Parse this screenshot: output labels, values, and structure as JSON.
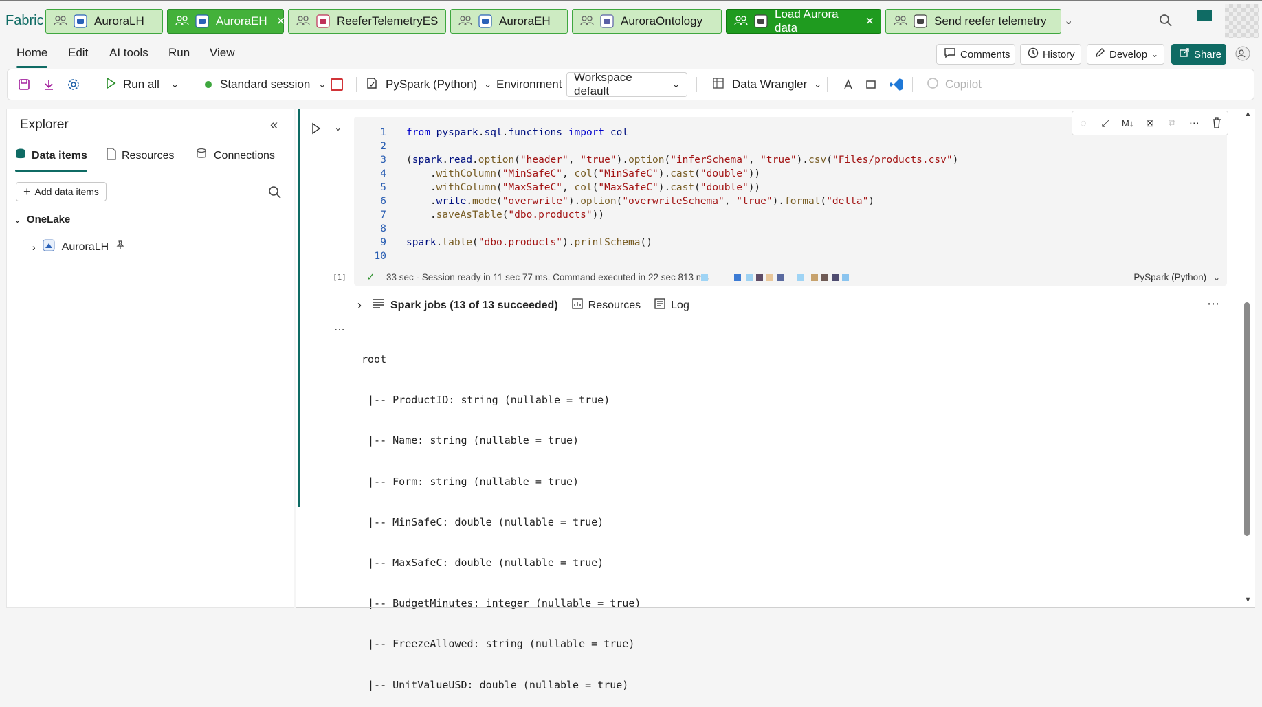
{
  "app": {
    "brand": "Fabric"
  },
  "tabs": [
    {
      "label": "AuroraLH",
      "state": "normal",
      "closable": false
    },
    {
      "label": "AuroraEH",
      "state": "active",
      "closable": true
    },
    {
      "label": "ReeferTelemetryES",
      "state": "normal",
      "closable": false
    },
    {
      "label": "AuroraEH",
      "state": "normal",
      "closable": false
    },
    {
      "label": "AuroraOntology",
      "state": "normal",
      "closable": false
    },
    {
      "label": "Load Aurora data",
      "state": "current",
      "closable": true
    },
    {
      "label": "Send reefer telemetry",
      "state": "normal",
      "closable": false
    }
  ],
  "menu": {
    "home": "Home",
    "edit": "Edit",
    "ai_tools": "AI tools",
    "run": "Run",
    "view": "View"
  },
  "header_actions": {
    "comments": "Comments",
    "history": "History",
    "develop": "Develop",
    "share": "Share"
  },
  "toolbar": {
    "run_all": "Run all",
    "session": "Standard session",
    "language": "PySpark (Python)",
    "environment": "Environment",
    "workspace_default": "Workspace default",
    "data_wrangler": "Data Wrangler",
    "copilot": "Copilot"
  },
  "explorer": {
    "title": "Explorer",
    "tabs": {
      "data_items": "Data items",
      "resources": "Resources",
      "connections": "Connections"
    },
    "add_items": "Add data items",
    "tree": {
      "root": "OneLake",
      "child": "AuroraLH"
    }
  },
  "cell": {
    "exec_count": "[1]",
    "status": "33 sec - Session ready in 11 sec 77 ms. Command executed in 22 sec 813 ms",
    "language": "PySpark (Python)",
    "line_numbers": [
      "1",
      "2",
      "3",
      "4",
      "5",
      "6",
      "7",
      "8",
      "9",
      "10"
    ],
    "spark_jobs": "Spark jobs (13 of 13 succeeded)",
    "resources": "Resources",
    "log": "Log"
  },
  "output": {
    "lines": [
      "root",
      " |-- ProductID: string (nullable = true)",
      " |-- Name: string (nullable = true)",
      " |-- Form: string (nullable = true)",
      " |-- MinSafeC: double (nullable = true)",
      " |-- MaxSafeC: double (nullable = true)",
      " |-- BudgetMinutes: integer (nullable = true)",
      " |-- FreezeAllowed: string (nullable = true)",
      " |-- UnitValueUSD: double (nullable = true)"
    ]
  },
  "colors": {
    "accent": "#0f6b64",
    "tab_green": "#cdebc2",
    "tab_active": "#43b13a",
    "tab_current": "#1f9b1f"
  }
}
